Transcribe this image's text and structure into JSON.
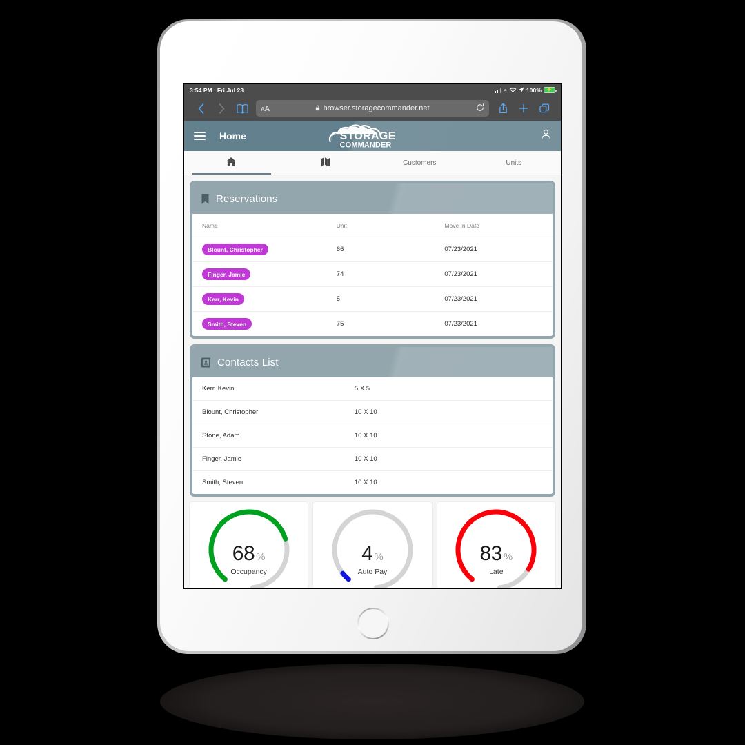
{
  "status_bar": {
    "time": "3:54 PM",
    "date": "Fri Jul 23",
    "battery_percent": "100%",
    "signal_icon": "cellular-signal-icon",
    "wifi_icon": "wifi-icon",
    "location_icon": "location-arrow-icon",
    "battery_icon": "battery-charging-icon"
  },
  "browser": {
    "back_icon": "chevron-left-icon",
    "forward_icon": "chevron-right-icon",
    "bookmarks_icon": "book-icon",
    "text_size_label_big": "A",
    "text_size_label_small": "A",
    "lock_icon": "lock-icon",
    "url": "browser.storagecommander.net",
    "reload_icon": "reload-icon",
    "share_icon": "share-icon",
    "new_tab_icon": "plus-icon",
    "tabs_icon": "tabs-icon"
  },
  "app_header": {
    "menu_icon": "hamburger-menu-icon",
    "title": "Home",
    "logo_line1": "STORAGE",
    "logo_line2": "COMMANDER",
    "account_icon": "person-icon",
    "background_color": "#62808d"
  },
  "tabs": [
    {
      "label": "",
      "icon": "home-icon",
      "active": true
    },
    {
      "label": "",
      "icon": "map-icon",
      "active": false
    },
    {
      "label": "Customers",
      "icon": "",
      "active": false
    },
    {
      "label": "Units",
      "icon": "",
      "active": false
    }
  ],
  "reservations": {
    "icon": "bookmark-icon",
    "title": "Reservations",
    "columns": [
      "Name",
      "Unit",
      "Move In Date"
    ],
    "rows": [
      {
        "name": "Blount, Christopher",
        "unit": "66",
        "move_in_date": "07/23/2021"
      },
      {
        "name": "Finger, Jamie",
        "unit": "74",
        "move_in_date": "07/23/2021"
      },
      {
        "name": "Kerr, Kevin",
        "unit": "5",
        "move_in_date": "07/23/2021"
      },
      {
        "name": "Smith, Steven",
        "unit": "75",
        "move_in_date": "07/23/2021"
      }
    ],
    "pill_color": "#c039d6"
  },
  "contacts": {
    "icon": "contact-card-icon",
    "title": "Contacts List",
    "rows": [
      {
        "name": "Kerr, Kevin",
        "size": "5 X 5"
      },
      {
        "name": "Blount, Christopher",
        "size": "10 X 10"
      },
      {
        "name": "Stone, Adam",
        "size": "10 X 10"
      },
      {
        "name": "Finger, Jamie",
        "size": "10 X 10"
      },
      {
        "name": "Smith, Steven",
        "size": "10 X 10"
      }
    ]
  },
  "chart_data": [
    {
      "type": "pie",
      "title": "Occupancy",
      "value": 68,
      "max": 100,
      "unit": "%",
      "color": "#00a11e",
      "track_color": "#d4d4d4"
    },
    {
      "type": "pie",
      "title": "Auto Pay",
      "value": 4,
      "max": 100,
      "unit": "%",
      "color": "#1414e0",
      "track_color": "#d4d4d4"
    },
    {
      "type": "pie",
      "title": "Late",
      "value": 83,
      "max": 100,
      "unit": "%",
      "color": "#fb0008",
      "track_color": "#d4d4d4"
    }
  ]
}
